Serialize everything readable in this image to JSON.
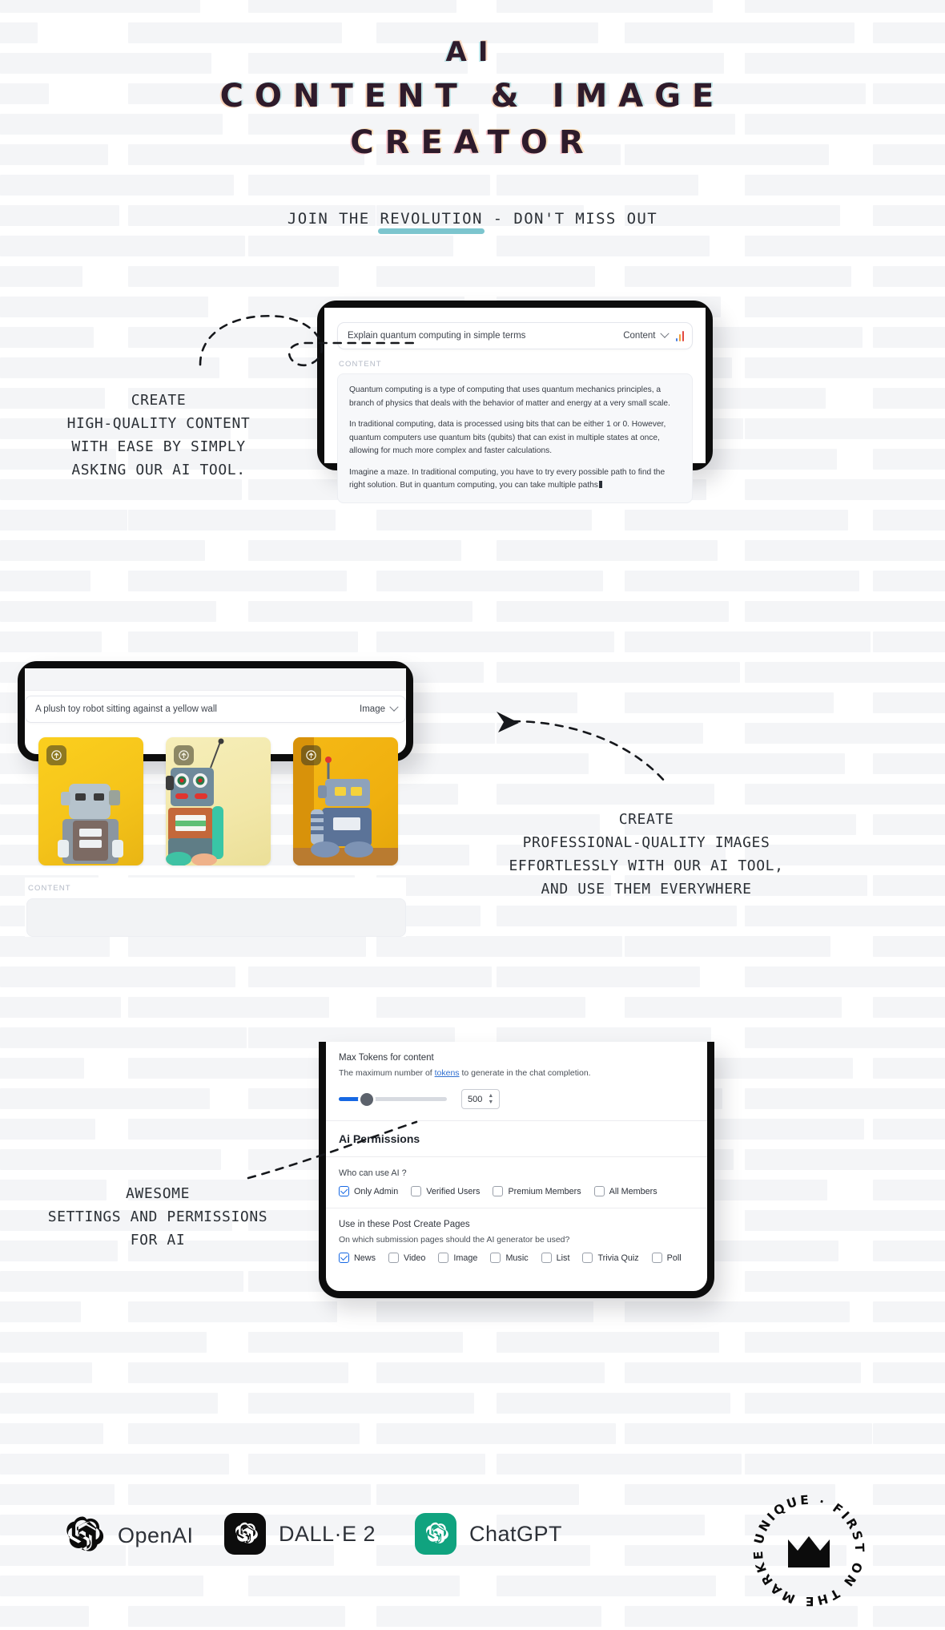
{
  "hero": {
    "title_line1": "AI",
    "title_line2": "CONTENT & IMAGE",
    "title_line3": "CREATOR",
    "subtitle_pre": "JOIN THE ",
    "subtitle_highlight": "REVOLUTION",
    "subtitle_post": " - DON'T MISS OUT",
    "accent_underline_color": "#7cc5ce",
    "title_color": "#2e1b2b"
  },
  "captions": {
    "content": "CREATE\nHIGH-QUALITY CONTENT\nWITH EASE BY SIMPLY\nASKING OUR AI TOOL.",
    "image": "CREATE\nPROFESSIONAL-QUALITY IMAGES\nEFFORTLESSLY WITH OUR AI TOOL,\nAND USE THEM EVERYWHERE",
    "settings": "AWESOME\nSETTINGS AND PERMISSIONS\nFOR AI"
  },
  "panel_content": {
    "prompt_value": "Explain quantum computing in simple terms",
    "type_selected": "Content",
    "equalizer_icon": "audio-bars-icon",
    "section_label": "CONTENT",
    "paragraphs": [
      "Quantum computing is a type of computing that uses quantum mechanics principles, a branch of physics that deals with the behavior of matter and energy at a very small scale.",
      "In traditional computing, data is processed using bits that can be either 1 or 0. However, quantum computers use quantum bits (qubits) that can exist in multiple states at once, allowing for much more complex and faster calculations.",
      "Imagine a maze. In traditional computing, you have to try every possible path to find the right solution. But in quantum computing, you can take multiple paths"
    ]
  },
  "panel_image": {
    "prompt_value": "A plush toy robot sitting against a yellow wall",
    "type_selected": "Image",
    "section_label": "CONTENT",
    "thumbnails": [
      {
        "name": "grey-plush-robot-on-yellow-wall",
        "badge_icon": "upload-arrow-icon"
      },
      {
        "name": "orange-teal-tin-robot-on-cream-wall",
        "badge_icon": "upload-arrow-icon"
      },
      {
        "name": "blue-toy-robot-on-yellow-textured-wall",
        "badge_icon": "upload-arrow-icon"
      }
    ]
  },
  "panel_settings": {
    "max_tokens_label": "Max Tokens for content",
    "max_tokens_desc_pre": "The maximum number of ",
    "max_tokens_link": "tokens",
    "max_tokens_desc_post": " to generate in the chat completion.",
    "slider_value": "500",
    "permissions_heading": "Ai Permissions",
    "who_label": "Who can use AI ?",
    "who_options": [
      {
        "label": "Only Admin",
        "checked": true
      },
      {
        "label": "Verified Users",
        "checked": false
      },
      {
        "label": "Premium Members",
        "checked": false
      },
      {
        "label": "All Members",
        "checked": false
      }
    ],
    "pages_label": "Use in these Post Create Pages",
    "pages_desc": "On which submission pages should the AI generator be used?",
    "pages_options": [
      {
        "label": "News",
        "checked": true
      },
      {
        "label": "Video",
        "checked": false
      },
      {
        "label": "Image",
        "checked": false
      },
      {
        "label": "Music",
        "checked": false
      },
      {
        "label": "List",
        "checked": false
      },
      {
        "label": "Trivia Quiz",
        "checked": false
      },
      {
        "label": "Poll",
        "checked": false
      }
    ],
    "accent_color": "#1668e3"
  },
  "logos": [
    {
      "label": "OpenAI",
      "icon": "openai-knot-icon",
      "style": "plain"
    },
    {
      "label": "DALL·E 2",
      "icon": "openai-knot-icon",
      "style": "black-tile"
    },
    {
      "label": "ChatGPT",
      "icon": "openai-knot-icon",
      "style": "green-tile"
    }
  ],
  "badge": {
    "ring_text": "UNIQUE · FIRST ON THE MARKET ·",
    "center_icon": "crown-icon"
  }
}
